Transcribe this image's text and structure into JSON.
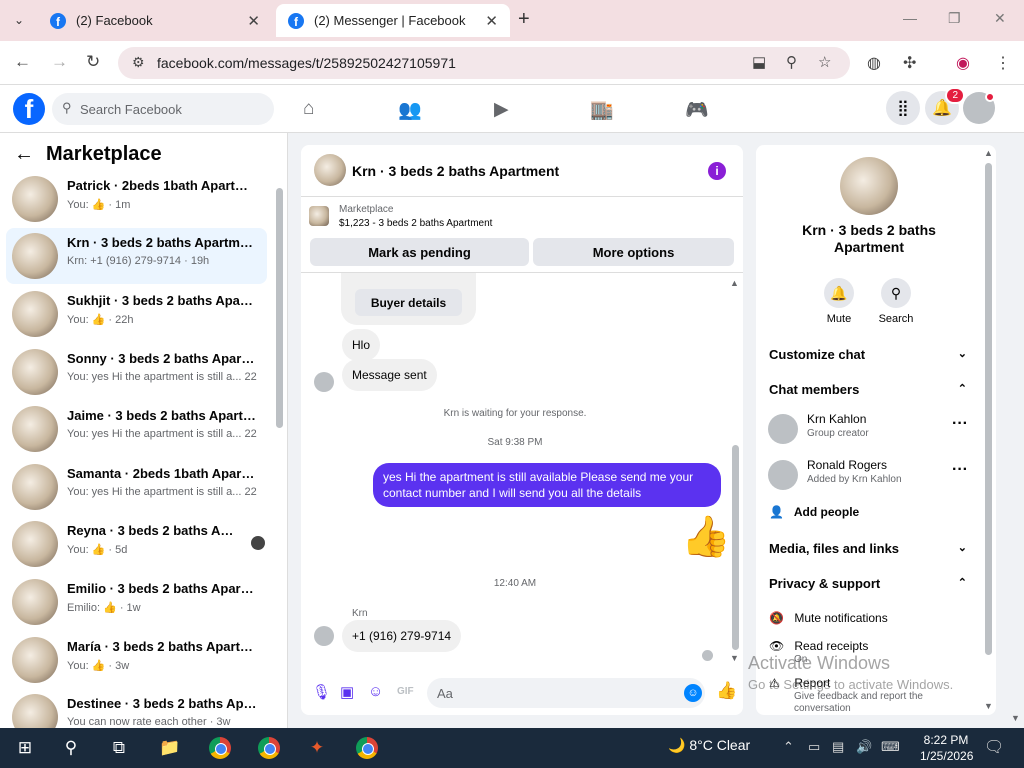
{
  "browser": {
    "tabs": [
      {
        "title": "(2) Facebook"
      },
      {
        "title": "(2) Messenger | Facebook"
      }
    ],
    "url": "facebook.com/messages/t/25892502427105971"
  },
  "fb": {
    "search_placeholder": "Search Facebook",
    "notification_count": "2"
  },
  "sidebar": {
    "title": "Marketplace",
    "conversations": [
      {
        "name": "Patrick · 2beds 1bath Apartment",
        "snippet": "You: 👍 · 1m"
      },
      {
        "name": "Krn · 3 beds 2 baths Apartment",
        "snippet": "Krn: +1 (916) 279-9714 · 19h"
      },
      {
        "name": "Sukhjit · 3 beds 2 baths Apartm...",
        "snippet": "You: 👍 · 22h"
      },
      {
        "name": "Sonny · 3 beds 2 baths Apartme...",
        "snippet": "You: yes Hi the apartment is still a... 22h"
      },
      {
        "name": "Jaime · 3 beds 2 baths Apartment",
        "snippet": "You: yes Hi the apartment is still a... 22h"
      },
      {
        "name": "Samanta · 2beds 1bath Apartme...",
        "snippet": "You: yes Hi the apartment is still a... 22h"
      },
      {
        "name": "Reyna · 3 beds 2 baths Apart...",
        "snippet": "You: 👍 · 5d"
      },
      {
        "name": "Emilio · 3 beds 2 baths Apartme...",
        "snippet": "Emilio: 👍 · 1w"
      },
      {
        "name": "María · 3 beds 2 baths Apartment",
        "snippet": "You: 👍 · 3w"
      },
      {
        "name": "Destinee · 3 beds 2 baths Apart...",
        "snippet": "You can now rate each other · 3w"
      }
    ]
  },
  "chat": {
    "title": "Krn · 3 beds 2 baths Apartment",
    "marketplace_label": "Marketplace",
    "listing": "$1,223 - 3 beds 2 baths Apartment",
    "mark_pending": "Mark as pending",
    "more_options": "More options",
    "buyer_details": "Buyer details",
    "msg_hlo": "Hlo",
    "msg_sent": "Message sent",
    "waiting": "Krn is waiting for your response.",
    "time1": "Sat 9:38 PM",
    "outgoing": "yes Hi the apartment is still available Please send me your contact number and I will send you all the details",
    "time2": "12:40 AM",
    "sender": "Krn",
    "msg_phone": "+1 (916) 279-9714",
    "composer_placeholder": "Aa"
  },
  "details": {
    "title": "Krn · 3 beds 2 baths Apartment",
    "mute": "Mute",
    "search": "Search",
    "customize": "Customize chat",
    "members_heading": "Chat members",
    "members": [
      {
        "name": "Krn Kahlon",
        "role": "Group creator"
      },
      {
        "name": "Ronald Rogers",
        "role": "Added by Krn Kahlon"
      }
    ],
    "add_people": "Add people",
    "media": "Media, files and links",
    "privacy": "Privacy & support",
    "mute_notifications": "Mute notifications",
    "read_receipts": "Read receipts",
    "read_receipts_sub": "On",
    "report": "Report",
    "report_sub": "Give feedback and report the conversation"
  },
  "watermark": {
    "line1": "Activate Windows",
    "line2": "Go to Settings to activate Windows."
  },
  "taskbar": {
    "weather": "8°C  Clear",
    "time": "8:22 PM",
    "date": "1/25/2026"
  },
  "colors": {
    "brand": "#0866ff",
    "chat_accent": "#5b32f0"
  }
}
